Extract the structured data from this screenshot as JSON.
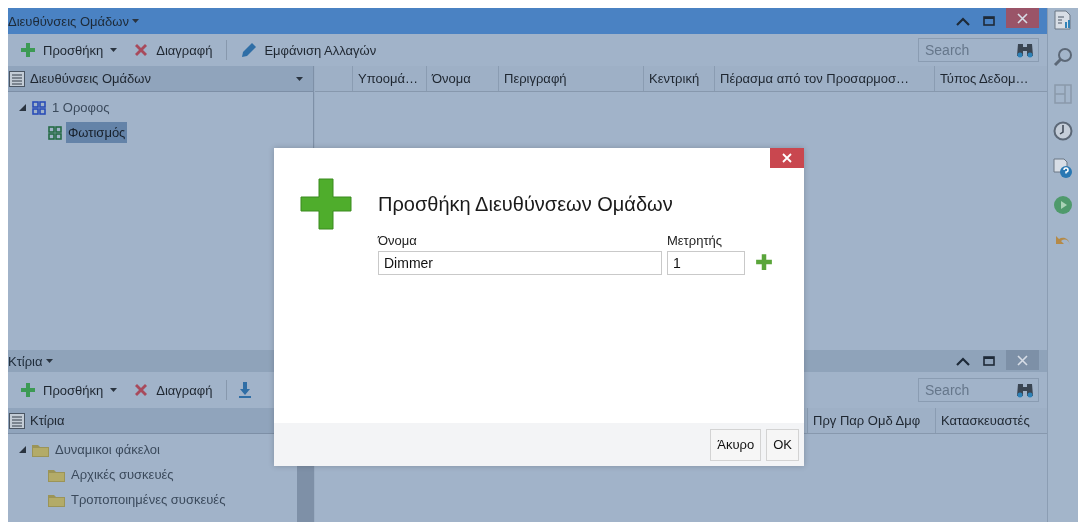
{
  "top_panel": {
    "title": "Διευθύνσεις Ομάδων",
    "active": true,
    "toolbar": [
      {
        "kind": "add",
        "label": "Προσθήκη",
        "dropdown": true
      },
      {
        "kind": "delete",
        "label": "Διαγραφή",
        "dropdown": false
      },
      {
        "kind": "edit",
        "label": "Εμφάνιση Αλλαγών",
        "dropdown": false
      }
    ],
    "search": {
      "placeholder": "Search"
    },
    "tree": {
      "header": "Διευθύνσεις Ομάδων",
      "items": [
        {
          "kind": "group",
          "label": "1 Οροφος",
          "expanded": true,
          "selected": false,
          "children": [
            {
              "kind": "group-leaf",
              "label": "Φωτισμός",
              "selected": true
            }
          ]
        }
      ]
    },
    "grid": {
      "columns": [
        "Υποομά…",
        "Όνομα",
        "Περιγραφή",
        "Κεντρική",
        "Πέρασμα από τον Προσαρμοσ…",
        "Τύπος Δεδομ…"
      ]
    }
  },
  "bottom_panel": {
    "title": "Κτίρια",
    "active": false,
    "toolbar": [
      {
        "kind": "add",
        "label": "Προσθήκη",
        "dropdown": true
      },
      {
        "kind": "delete",
        "label": "Διαγραφή",
        "dropdown": false
      },
      {
        "kind": "download"
      }
    ],
    "search": {
      "placeholder": "Search"
    },
    "tree": {
      "header": "Κτίρια",
      "items": [
        {
          "kind": "folder",
          "label": "Δυναμικοι φάκελοι",
          "expanded": true,
          "selected": false,
          "children": [
            {
              "kind": "folder",
              "label": "Αρχικές συσκευές",
              "selected": false
            },
            {
              "kind": "folder",
              "label": "Τροποποιημένες συσκευές",
              "selected": false
            }
          ]
        }
      ]
    },
    "grid": {
      "columns": [
        "Πργ Παρ Ομδ Δμφ",
        "Κατασκευαστές"
      ]
    }
  },
  "side_toolbar": [
    {
      "kind": "report"
    },
    {
      "kind": "search"
    },
    {
      "kind": "layout"
    },
    {
      "kind": "history"
    },
    {
      "kind": "help"
    },
    {
      "kind": "play"
    },
    {
      "kind": "undo"
    }
  ],
  "dialog": {
    "title": "Προσθήκη Διευθύνσεων Ομάδων",
    "name_field": {
      "label": "Όνομα",
      "value": "Dimmer"
    },
    "counter_field": {
      "label": "Μετρητής",
      "value": "1"
    },
    "buttons": [
      "Άκυρο",
      "OK"
    ]
  }
}
